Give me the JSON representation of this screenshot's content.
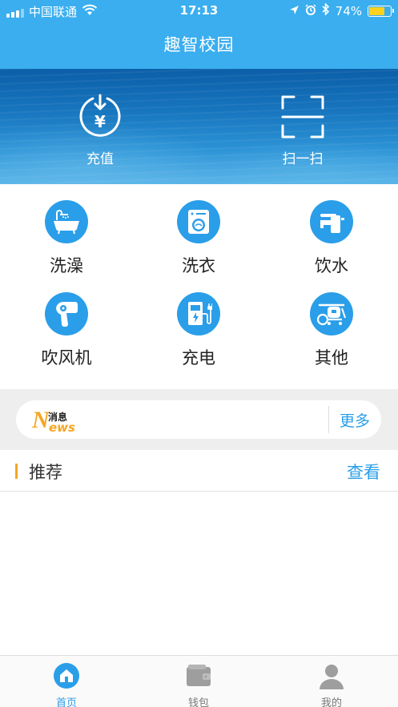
{
  "status_bar": {
    "carrier": "中国联通",
    "time": "17:13",
    "battery_percent": "74%",
    "battery_level": 0.74,
    "icons": [
      "signal-icon",
      "wifi-icon",
      "location-icon",
      "alarm-icon",
      "bluetooth-icon",
      "battery-icon"
    ]
  },
  "nav": {
    "title": "趣智校园"
  },
  "banner": {
    "recharge_label": "充值",
    "scan_label": "扫一扫"
  },
  "services": [
    {
      "label": "洗澡",
      "icon": "bathtub-icon"
    },
    {
      "label": "洗衣",
      "icon": "washing-machine-icon"
    },
    {
      "label": "饮水",
      "icon": "faucet-icon"
    },
    {
      "label": "吹风机",
      "icon": "hair-dryer-icon"
    },
    {
      "label": "充电",
      "icon": "charger-icon"
    },
    {
      "label": "其他",
      "icon": "other-icon"
    }
  ],
  "news": {
    "logo_text_top": "消息",
    "logo_text_n": "N",
    "logo_text_ews": "ews",
    "more_label": "更多"
  },
  "recommend": {
    "title": "推荐",
    "view_label": "查看"
  },
  "tabbar": {
    "tabs": [
      {
        "label": "首页",
        "icon": "home-icon",
        "active": true
      },
      {
        "label": "钱包",
        "icon": "wallet-icon",
        "active": false
      },
      {
        "label": "我的",
        "icon": "profile-icon",
        "active": false
      }
    ]
  },
  "colors": {
    "primary": "#3aaeef",
    "icon_blue": "#2a9ee9",
    "accent_orange": "#f5a623",
    "battery_yellow": "#ffd21f"
  }
}
